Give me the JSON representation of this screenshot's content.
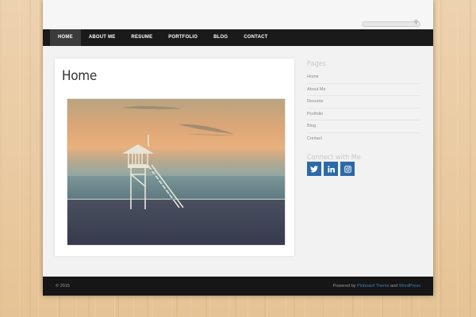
{
  "nav": {
    "items": [
      {
        "label": "HOME",
        "active": true
      },
      {
        "label": "ABOUT ME"
      },
      {
        "label": "RESUME"
      },
      {
        "label": "PORTFOLIO"
      },
      {
        "label": "BLOG"
      },
      {
        "label": "CONTACT"
      }
    ]
  },
  "search": {
    "placeholder": "",
    "icon": "search-icon"
  },
  "content": {
    "title": "Home",
    "image": {
      "subject": "lifeguard-tower-beach-photo"
    }
  },
  "sidebar": {
    "pages_title": "Pages",
    "pages": [
      "Home",
      "About Me",
      "Resume",
      "Portfolio",
      "Blog",
      "Contact"
    ],
    "connect_title": "Connect with Me",
    "social": [
      {
        "icon": "twitter-icon"
      },
      {
        "icon": "linkedin-icon"
      },
      {
        "icon": "instagram-icon"
      }
    ]
  },
  "footer": {
    "copyright": "© 2015",
    "powered_prefix": "Powered by ",
    "theme_link": "Pinboard Theme",
    "and": " and ",
    "wp_link": "WordPress"
  },
  "colors": {
    "nav_bg": "#1a1a1a",
    "nav_active": "#3b3b3b",
    "social": "#2c6aa8",
    "link": "#3f7fbf",
    "footer_bg": "#161616"
  }
}
